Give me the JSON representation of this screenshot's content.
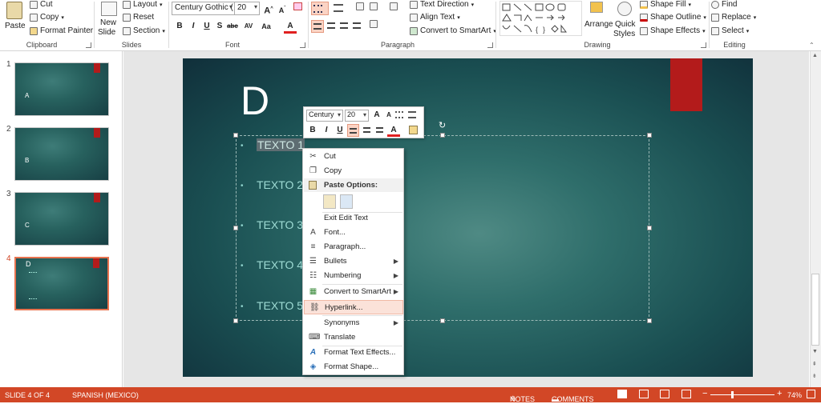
{
  "ribbon": {
    "clipboard": {
      "paste": "Paste",
      "cut": "Cut",
      "copy": "Copy",
      "format_painter": "Format Painter",
      "group": "Clipboard"
    },
    "slides": {
      "new_slide_1": "New",
      "new_slide_2": "Slide",
      "layout": "Layout",
      "reset": "Reset",
      "section": "Section",
      "group": "Slides"
    },
    "font": {
      "name": "Century Gothic (",
      "size": "20",
      "bold": "B",
      "italic": "I",
      "underline": "U",
      "strike": "S",
      "shadow": "abc",
      "spacing": "AV",
      "case": "Aa",
      "color": "A",
      "grow": "A",
      "shrink": "A",
      "group": "Font"
    },
    "paragraph": {
      "text_direction": "Text Direction",
      "align_text": "Align Text",
      "smartart": "Convert to SmartArt",
      "group": "Paragraph"
    },
    "drawing": {
      "arrange": "Arrange",
      "quick_styles_1": "Quick",
      "quick_styles_2": "Styles",
      "shape_fill": "Shape Fill",
      "shape_outline": "Shape Outline",
      "shape_effects": "Shape Effects",
      "group": "Drawing"
    },
    "editing": {
      "find": "Find",
      "replace": "Replace",
      "select": "Select",
      "group": "Editing"
    }
  },
  "thumbnails": [
    {
      "num": "1",
      "text": "A"
    },
    {
      "num": "2",
      "text": "B"
    },
    {
      "num": "3",
      "text": "C"
    },
    {
      "num": "4",
      "text": "D"
    }
  ],
  "slide": {
    "title": "D",
    "bullets": [
      "TEXTO 1",
      "TEXTO 2",
      "TEXTO 3",
      "TEXTO 4",
      "TEXTO 5"
    ]
  },
  "mini_toolbar": {
    "font": "Century",
    "size": "20",
    "bold": "B",
    "italic": "I",
    "underline": "U",
    "grow": "A",
    "shrink": "A",
    "color": "A"
  },
  "context_menu": {
    "cut": "Cut",
    "copy": "Copy",
    "paste_options": "Paste Options:",
    "exit_edit": "Exit Edit Text",
    "font": "Font...",
    "paragraph": "Paragraph...",
    "bullets": "Bullets",
    "numbering": "Numbering",
    "smartart": "Convert to SmartArt",
    "hyperlink": "Hyperlink...",
    "synonyms": "Synonyms",
    "translate": "Translate",
    "text_effects": "Format Text Effects...",
    "format_shape": "Format Shape..."
  },
  "status": {
    "slide": "SLIDE 4 OF 4",
    "language": "SPANISH (MEXICO)",
    "notes": "NOTES",
    "comments": "COMMENTS",
    "zoom": "74%"
  },
  "colors": {
    "accent": "#d24726",
    "slide_red": "#b31b1b",
    "text_teal": "#9edbd4"
  }
}
